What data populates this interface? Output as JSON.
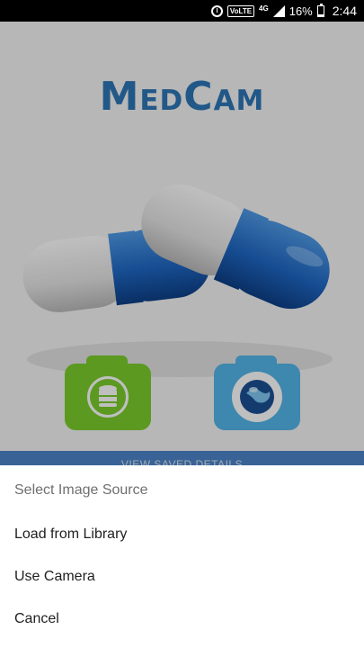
{
  "status_bar": {
    "network_badge": "VoLTE",
    "network_type": "4G",
    "battery": "16%",
    "time": "2:44"
  },
  "app": {
    "title": "MedCam",
    "view_saved_label": "VIEW SAVED DETAILS",
    "colors": {
      "title": "#2e76b6",
      "green_button": "#7bcc2d",
      "blue_button": "#53b4e8",
      "bar": "#4d84c8"
    }
  },
  "sheet": {
    "title": "Select Image Source",
    "options": [
      "Load from Library",
      "Use Camera",
      "Cancel"
    ]
  },
  "icons": [
    "alarm-icon",
    "signal-icon",
    "battery-icon",
    "database-camera-icon",
    "globe-camera-icon"
  ]
}
